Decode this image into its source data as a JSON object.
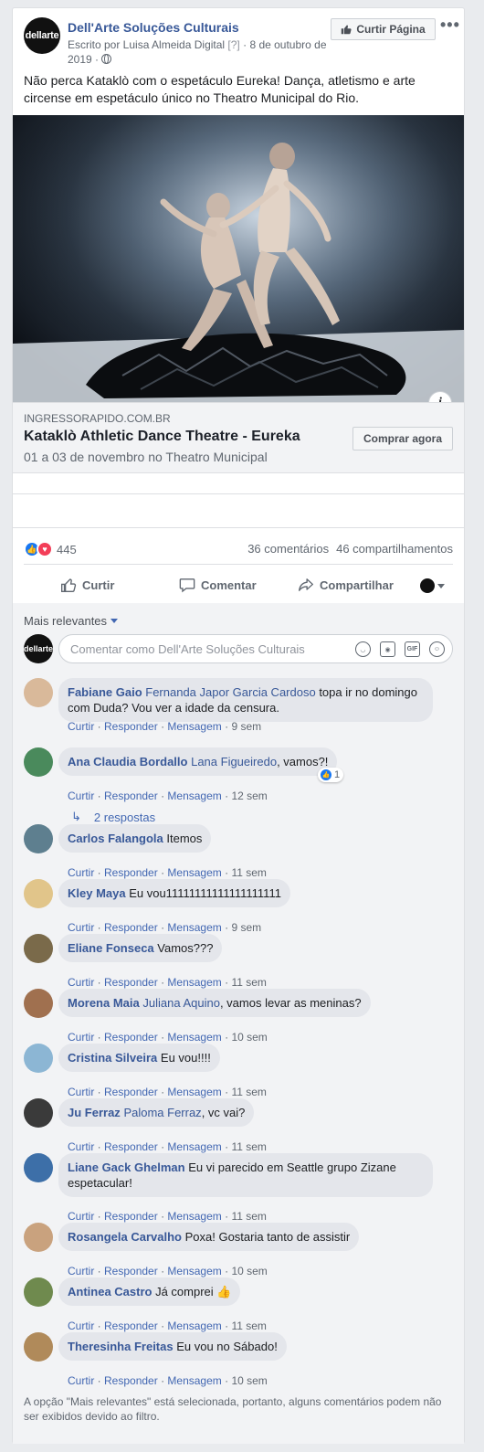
{
  "post": {
    "page_name": "Dell'Arte Soluções Culturais",
    "avatar_text": "dellarte",
    "byline_prefix": "Escrito por Luisa Almeida Digital",
    "byline_help": "[?]",
    "byline_date": "· 8 de outubro de 2019 ·",
    "like_page_label": "Curtir Página",
    "more_label": "•••",
    "text": "Não perca Kataklò com o espetáculo Eureka! Dança, atletismo e arte circense em espetáculo único no Theatro Municipal do Rio."
  },
  "link": {
    "domain": "INGRESSORAPIDO.COM.BR",
    "title": "Kataklò Athletic Dance Theatre - Eureka",
    "description": "01 a 03 de novembro no Theatro Municipal",
    "cta": "Comprar agora",
    "info_label": "i"
  },
  "stats": {
    "reaction_count": "445",
    "comments": "36 comentários",
    "shares": "46 compartilhamentos"
  },
  "actions": {
    "like": "Curtir",
    "comment": "Comentar",
    "share": "Compartilhar"
  },
  "comments_section": {
    "sort_label": "Mais relevantes",
    "composer_placeholder": "Comentar como Dell'Arte Soluções Culturais",
    "composer_avatar_text": "dellarte",
    "gif_label": "GIF",
    "filter_note": "A opção \"Mais relevantes\" está selecionada, portanto, alguns comentários podem não ser exibidos devido ao filtro."
  },
  "meta_labels": {
    "like": "Curtir",
    "reply": "Responder",
    "message": "Mensagem",
    "sep": " · "
  },
  "comments": [
    {
      "author": "Fabiane Gaio",
      "tag": "Fernanda Japor Garcia Cardoso",
      "text": " topa ir no domingo com Duda? Vou ver a idade da censura.",
      "time": "9 sem",
      "avatar_color": "#d9b99a"
    },
    {
      "author": "Ana Claudia Bordallo",
      "tag": "Lana Figueiredo",
      "text": ", vamos?!",
      "time": "12 sem",
      "reaction_count": "1",
      "replies": "2 respostas",
      "avatar_color": "#4a8a5c"
    },
    {
      "author": "Carlos Falangola",
      "tag": "",
      "text": " Itemos",
      "time": "11 sem",
      "avatar_color": "#5e7f8f"
    },
    {
      "author": "Kley Maya",
      "tag": "",
      "text": " Eu vou11111111111111111111",
      "time": "9 sem",
      "avatar_color": "#e1c58a"
    },
    {
      "author": "Eliane Fonseca",
      "tag": "",
      "text": " Vamos???",
      "time": "11 sem",
      "avatar_color": "#7a6a4a"
    },
    {
      "author": "Morena Maia",
      "tag": "Juliana Aquino",
      "text": ", vamos levar as meninas?",
      "time": "10 sem",
      "avatar_color": "#a0704f"
    },
    {
      "author": "Cristina Silveira",
      "tag": "",
      "text": " Eu vou!!!!",
      "time": "11 sem",
      "avatar_color": "#8cb6d4"
    },
    {
      "author": "Ju Ferraz",
      "tag": "Paloma Ferraz",
      "text": ", vc vai?",
      "time": "11 sem",
      "avatar_color": "#3a3a3a"
    },
    {
      "author": "Liane Gack Ghelman",
      "tag": "",
      "text": " Eu vi parecido em Seattle grupo Zizane espetacular!",
      "time": "11 sem",
      "avatar_color": "#3d6fa8"
    },
    {
      "author": "Rosangela Carvalho",
      "tag": "",
      "text": " Poxa! Gostaria tanto de assistir",
      "time": "10 sem",
      "avatar_color": "#c9a27e"
    },
    {
      "author": "Antinea Castro",
      "tag": "",
      "text": " Já comprei 👍",
      "time": "11 sem",
      "avatar_color": "#6f8a4e"
    },
    {
      "author": "Theresinha Freitas",
      "tag": "",
      "text": " Eu vou no Sábado!",
      "time": "10 sem",
      "avatar_color": "#b08a5a"
    }
  ]
}
